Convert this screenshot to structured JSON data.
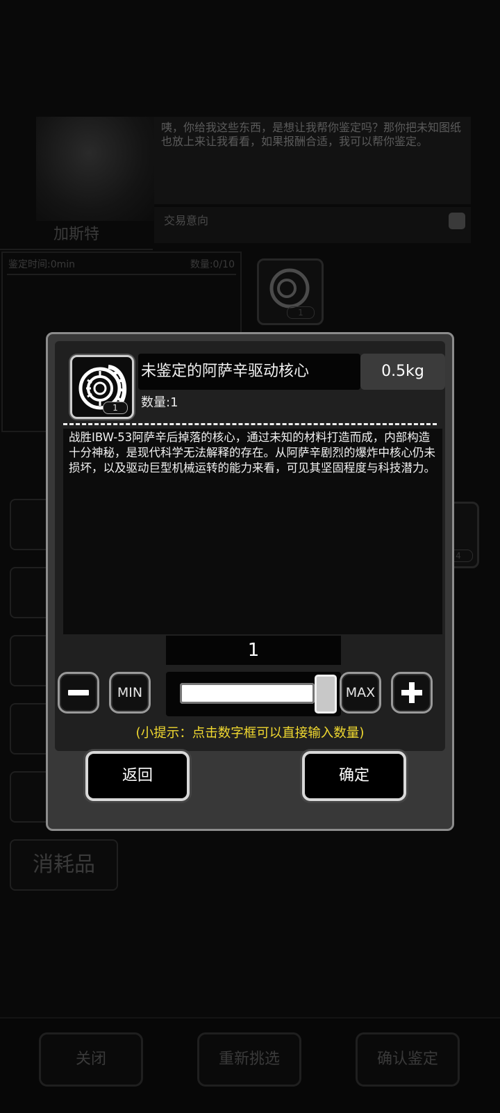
{
  "background": {
    "npc_name": "加斯特",
    "npc_speech": "咦，你给我这些东西，是想让我帮你鉴定吗？那你把未知图纸也放上来让我看看，如果报酬合适，我可以帮你鉴定。",
    "trade_label": "交易意向",
    "appraise_time": "鉴定时间:0min",
    "appraise_count": "数量:0/10",
    "slot_count_1": "1",
    "slot_count_2": "4",
    "category_consumables": "消耗品",
    "bottom_close": "关闭",
    "bottom_reselect": "重新挑选",
    "bottom_confirm_appraise": "确认鉴定"
  },
  "dialog": {
    "item_name": "未鉴定的阿萨辛驱动核心",
    "weight": "0.5kg",
    "quantity_label": "数量:1",
    "item_count_badge": "1",
    "description": "战胜IBW-53阿萨辛后掉落的核心，通过未知的材料打造而成，内部构造十分神秘，是现代科学无法解释的存在。从阿萨辛剧烈的爆炸中核心仍未损坏，以及驱动巨型机械运转的能力来看，可见其坚固程度与科技潜力。",
    "selected_quantity": "1",
    "min_label": "MIN",
    "max_label": "MAX",
    "slider_fraction": 1.0,
    "tip": "(小提示：点击数字框可以直接输入数量)",
    "back_label": "返回",
    "confirm_label": "确定"
  },
  "colors": {
    "tip": "#f0d830",
    "dialog_bg": "#383838",
    "dialog_border": "#8c8c8c"
  }
}
